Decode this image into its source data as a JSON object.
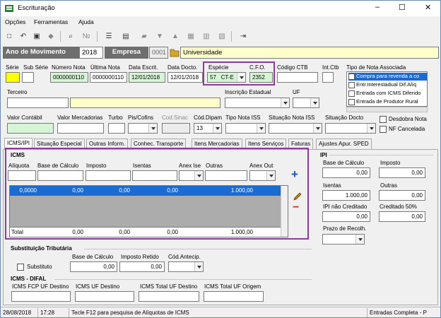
{
  "window": {
    "title": "Escrituração",
    "minimize": "–",
    "maximize": "☐",
    "close": "✕"
  },
  "menu": {
    "items": [
      "Opções",
      "Ferramentas",
      "Ajuda"
    ]
  },
  "year_bar": {
    "ano_label": "Ano de Movimento",
    "ano_value": "2018",
    "empresa_label": "Empresa",
    "empresa_code": "0001",
    "empresa_name": "Universidade"
  },
  "header_fields": {
    "serie_label": "Série",
    "sub_serie_label": "Sub Série",
    "numero_nota_label": "Número Nota",
    "numero_nota": "0000000110",
    "ultima_nota_label": "Última Nota",
    "ultima_nota": "0000000110",
    "data_escrit_label": "Data Escrit.",
    "data_escrit": "12/01/2018",
    "data_docto_label": "Data Docto.",
    "data_docto": "12/01/2018",
    "especie_label": "Espécie",
    "especie_value": "57   CT-E",
    "cfo_label": "C.F.O.",
    "cfo_value": "2352",
    "codigo_ctb_label": "Código CTB",
    "int_ctb_label": "Int.Ctb",
    "tipo_nota_label": "Tipo de Nota Associada",
    "tipo_nota_options": [
      "Compra para revenda a co",
      "Entr.Interestadual Dif.Alíq",
      "Entrada com ICMS Diferido",
      "Entrada de Produtor Rural"
    ],
    "terceiro_label": "Terceiro",
    "inscricao_label": "Inscrição Estadual",
    "uf_label": "UF"
  },
  "row3": {
    "valor_contabil_label": "Valor Contábil",
    "valor_mercadorias_label": "Valor Mercadorias",
    "turbo_label": "Turbo",
    "pis_cofins_label": "Pis/Cofins",
    "cod_sinac_label": "Cod.Sinac",
    "cod_dipam_label": "Cód.Dipam",
    "cod_dipam_value": "13",
    "tipo_nota_iss_label": "Tipo Nota ISS",
    "situacao_nota_iss_label": "Situação Nota ISS",
    "situacao_docto_label": "Situação Docto",
    "desdobra_nota_label": "Desdobra Nota",
    "nf_cancelada_label": "NF Cancelada"
  },
  "tabs": [
    "ICMS/IPI",
    "Situação Especial",
    "Outras Inform.",
    "Conhec. Transporte",
    "Itens Mercadorias",
    "Itens Serviços",
    "Faturas",
    "Ajustes Apur. SPED"
  ],
  "icms": {
    "title": "ICMS",
    "columns": [
      "Alíquota",
      "Base de Cálculo",
      "Imposto",
      "Isentas",
      "Anex Ise",
      "Outras",
      "Anex Out"
    ],
    "row": [
      "0,0000",
      "0,00",
      "0,00",
      "0,00",
      "1.000,00"
    ],
    "total_label": "Total",
    "total": [
      "0,00",
      "0,00",
      "0,00",
      "1.000,00"
    ],
    "add": "+",
    "remove": "−"
  },
  "ipi": {
    "title": "IPI",
    "base_label": "Base de Cálculo",
    "base": "0,00",
    "imposto_label": "Imposto",
    "imposto": "0,00",
    "isentas_label": "Isentas",
    "isentas": "1.000,00",
    "outras_label": "Outras",
    "outras": "0,00",
    "nao_creditado_label": "IPI não Creditado",
    "nao_creditado": "0,00",
    "creditado_label": "Creditado 50%",
    "creditado": "0,00",
    "prazo_label": "Prazo de Recolh."
  },
  "st": {
    "title": "Substituição Tributária",
    "substituto_label": "Substituto",
    "base_label": "Base de Cálculo",
    "base": "0,00",
    "imposto_label": "Imposto Retido",
    "imposto": "0,00",
    "cod_antecip_label": "Cód.Antecip."
  },
  "difal": {
    "title": "ICMS - DIFAL",
    "fcp_label": "ICMS FCP UF Destino",
    "uf_destino_label": "ICMS UF Destino",
    "total_destino_label": "ICMS Total UF Destino",
    "total_origem_label": "ICMS Total UF Origem"
  },
  "status": {
    "date": "28/08/2018",
    "time": "17:28",
    "hint": "Tecle F12 para pesquisa de Alíquotas de ICMS",
    "mode": "Entradas Completa - P"
  }
}
